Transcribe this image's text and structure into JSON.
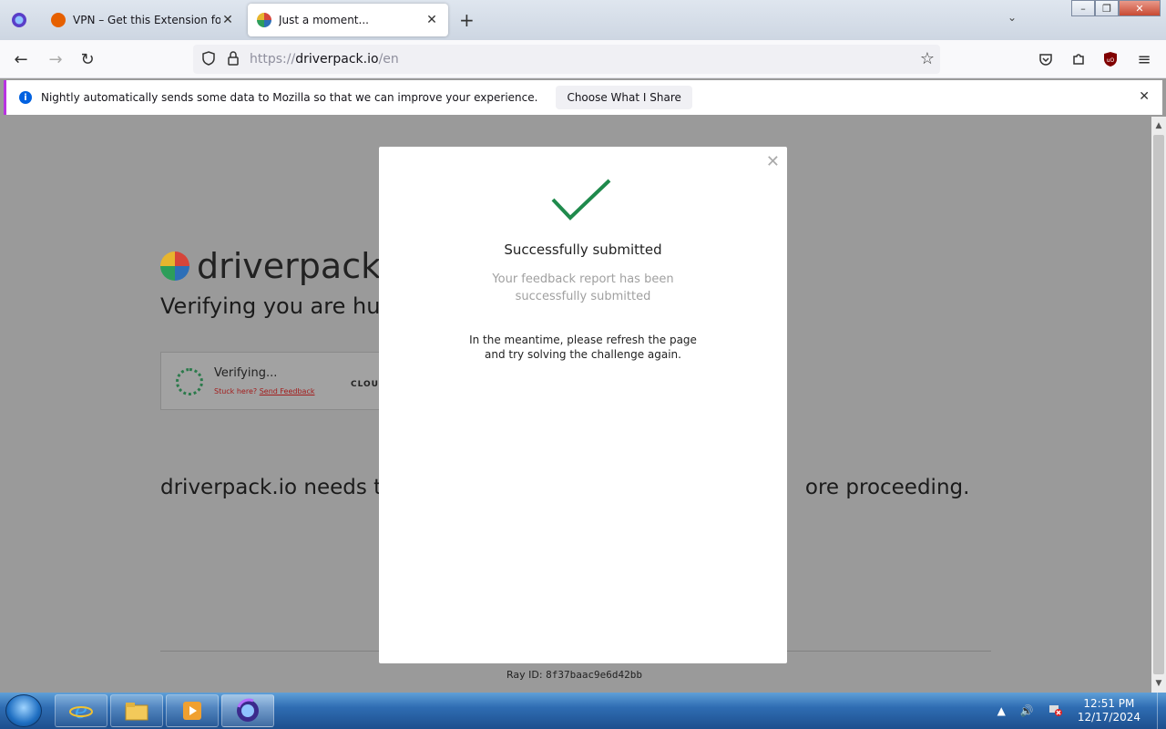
{
  "browser": {
    "tabs": [
      {
        "title": "VPN – Get this Extension for 🦋",
        "active": false,
        "favicon_color": "#e66000"
      },
      {
        "title": "Just a moment...",
        "active": true,
        "favicon_color": "#2d6fb8"
      }
    ],
    "url": {
      "scheme": "https://",
      "host": "driverpack.io",
      "path": "/en"
    },
    "notification": {
      "message": "Nightly automatically sends some data to Mozilla so that we can improve your experience.",
      "button": "Choose What I Share"
    }
  },
  "page": {
    "logo_text": "driverpack.io",
    "heading": "Verifying you are huma",
    "turnstile": {
      "status": "Verifying...",
      "stuck_text": "Stuck here?",
      "feedback_link": "Send Feedback",
      "brand": "CLOU"
    },
    "notice_left": "driverpack.io needs to",
    "notice_right": "ore proceeding.",
    "ray_label": "Ray ID:",
    "ray_id": "8f37baac9e6d42bb"
  },
  "modal": {
    "title": "Successfully submitted",
    "subtitle": "Your feedback report has been successfully submitted",
    "note": "In the meantime, please refresh the page and try solving the challenge again.",
    "accent_color": "#1f8a4c"
  },
  "taskbar": {
    "time": "12:51 PM",
    "date": "12/17/2024"
  }
}
